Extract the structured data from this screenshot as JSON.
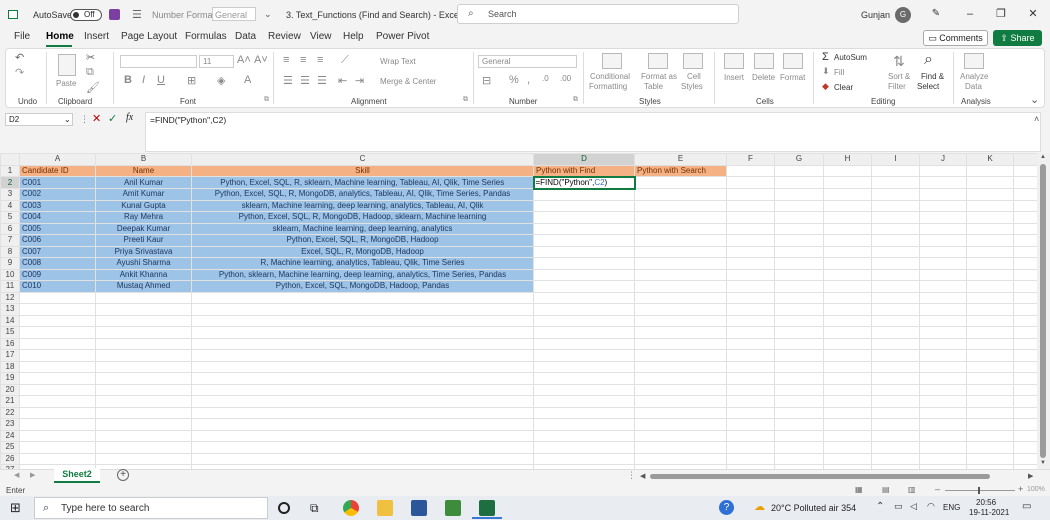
{
  "titlebar": {
    "autosave_label": "AutoSave",
    "autosave_state": "Off",
    "number_format_label": "Number Format",
    "number_format_value": "General",
    "doc_title": "3. Text_Functions (Find and Search)  -  Excel",
    "search_placeholder": "Search",
    "user_name": "Gunjan",
    "user_initial": "G"
  },
  "menu": {
    "tabs": [
      "File",
      "Home",
      "Insert",
      "Page Layout",
      "Formulas",
      "Data",
      "Review",
      "View",
      "Help",
      "Power Pivot"
    ],
    "comments_label": "Comments",
    "share_label": "Share"
  },
  "ribbon": {
    "groups": [
      "Undo",
      "Clipboard",
      "Font",
      "Alignment",
      "Number",
      "Styles",
      "Cells",
      "Editing",
      "Analysis"
    ],
    "paste_label": "Paste",
    "font_size": "11",
    "wrap_text": "Wrap Text",
    "merge_center": "Merge & Center",
    "number_format": "General",
    "conditional_formatting": [
      "Conditional",
      "Formatting"
    ],
    "format_as_table": [
      "Format as",
      "Table"
    ],
    "cell_styles": [
      "Cell",
      "Styles"
    ],
    "insert": "Insert",
    "delete": "Delete",
    "format": "Format",
    "autosum": "AutoSum",
    "fill": "Fill",
    "clear": "Clear",
    "sort_filter": [
      "Sort &",
      "Filter"
    ],
    "find_select": [
      "Find &",
      "Select"
    ],
    "analyze_data": [
      "Analyze",
      "Data"
    ]
  },
  "formula_bar": {
    "name_box": "D2",
    "fx": "fx",
    "formula": "=FIND(\"Python\",C2)"
  },
  "sheet": {
    "columns": [
      "A",
      "B",
      "C",
      "D",
      "E",
      "F",
      "G",
      "H",
      "I",
      "J",
      "K"
    ],
    "headers": [
      "Candidate ID",
      "Name",
      "Skill",
      "Python with Find",
      "Python with Search"
    ],
    "rows": [
      [
        "C001",
        "Anil Kumar",
        "Python, Excel, SQL, R, sklearn, Machine learning, Tableau, AI, Qlik, Time Series"
      ],
      [
        "C002",
        "Amit Kumar",
        "Python, Excel, SQL, R, MongoDB, analytics, Tableau, AI, Qlik, Time Series, Pandas"
      ],
      [
        "C003",
        "Kunal Gupta",
        "sklearn, Machine learning, deep learning, analytics, Tableau, AI, Qlik"
      ],
      [
        "C004",
        "Ray Mehra",
        "Python, Excel, SQL, R, MongoDB, Hadoop, sklearn, Machine learning"
      ],
      [
        "C005",
        "Deepak Kumar",
        "sklearn, Machine learning, deep learning, analytics"
      ],
      [
        "C006",
        "Preeti Kaur",
        "Python, Excel, SQL, R, MongoDB, Hadoop"
      ],
      [
        "C007",
        "Priya Srivastava",
        "Excel, SQL, R, MongoDB, Hadoop"
      ],
      [
        "C008",
        "Ayushi Sharma",
        "R, Machine learning, analytics, Tableau, Qlik, Time Series"
      ],
      [
        "C009",
        "Ankit Khanna",
        "Python, sklearn, Machine learning, deep learning, analytics, Time Series, Pandas"
      ],
      [
        "C010",
        "Mustaq Ahmed",
        "Python, Excel, SQL, MongoDB, Hadoop, Pandas"
      ]
    ],
    "editing_cell": {
      "prefix": "=FIND(\"Python\",",
      "ref": "C2",
      "suffix": ")"
    },
    "row_numbers": [
      "1",
      "2",
      "3",
      "4",
      "5",
      "6",
      "7",
      "8",
      "9",
      "10",
      "11",
      "12",
      "13",
      "14",
      "15",
      "16",
      "17",
      "18",
      "19",
      "20",
      "21",
      "22",
      "23",
      "24",
      "25",
      "26",
      "27"
    ],
    "sheet_tab": "Sheet2",
    "zoom": "100%"
  },
  "status": {
    "mode": "Enter"
  },
  "taskbar": {
    "search_placeholder": "Type here to search",
    "weather": "20°C  Polluted air 354",
    "language": "ENG",
    "time": "20:56",
    "date": "19-11-2021"
  }
}
